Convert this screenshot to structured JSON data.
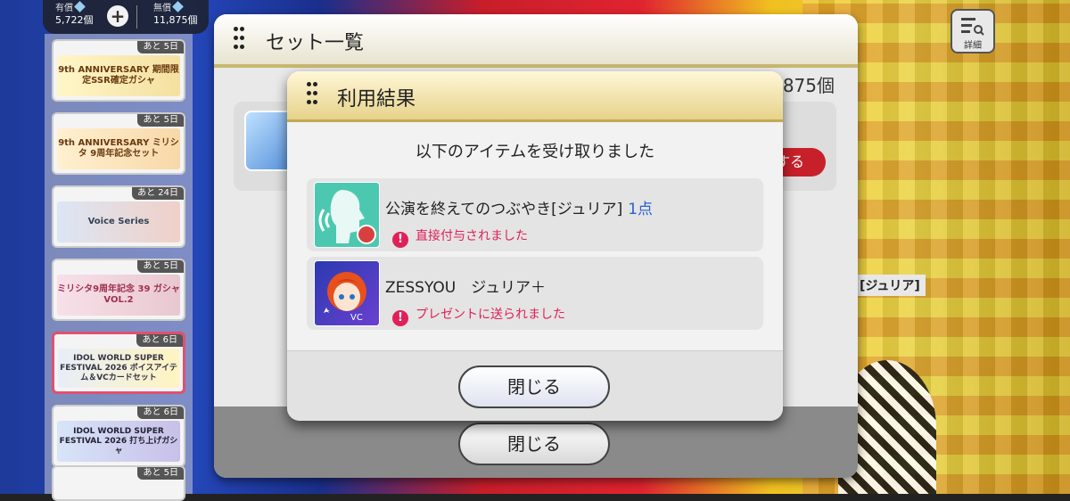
{
  "currency": {
    "paid_label": "有償",
    "paid_value": "5,722個",
    "free_label": "無償",
    "free_value": "11,875個"
  },
  "detail_button": {
    "label": "詳細"
  },
  "sidebar": {
    "items": [
      {
        "tag": "あと 5日",
        "banner": "9th ANNIVERSARY 期間限定SSR確定ガシャ"
      },
      {
        "tag": "あと 5日",
        "banner": "9th ANNIVERSARY ミリシタ 9周年記念セット"
      },
      {
        "tag": "あと 24日",
        "banner": "Voice Series"
      },
      {
        "tag": "あと 5日",
        "banner": "ミリシタ9周年記念 39 ガシャ VOL.2"
      },
      {
        "tag": "あと 6日",
        "banner": "IDOL WORLD SUPER FESTIVAL 2026 ボイスアイテム＆VCカードセット"
      },
      {
        "tag": "あと 6日",
        "banner": "IDOL WORLD SUPER FESTIVAL 2026 打ち上げガシャ"
      },
      {
        "tag": "あと 5日",
        "banner": ""
      }
    ]
  },
  "panel": {
    "title": "セット一覧",
    "count_text": "1875個",
    "action_label": "する",
    "close_label": "閉じる"
  },
  "modal": {
    "title": "利用結果",
    "message": "以下のアイテムを受け取りました",
    "items": [
      {
        "name": "公演を終えてのつぶやき[ジュリア]",
        "count": "1点",
        "note": "直接付与されました"
      },
      {
        "name": "ZESSYOU　ジュリア＋",
        "count": "",
        "note": "プレゼントに送られました"
      }
    ],
    "close_label": "閉じる"
  },
  "background": {
    "label": "[ジュリア]"
  },
  "colors": {
    "accent_gold": "#c8b870",
    "note_pink": "#e0205a",
    "count_blue": "#2a60d0"
  }
}
